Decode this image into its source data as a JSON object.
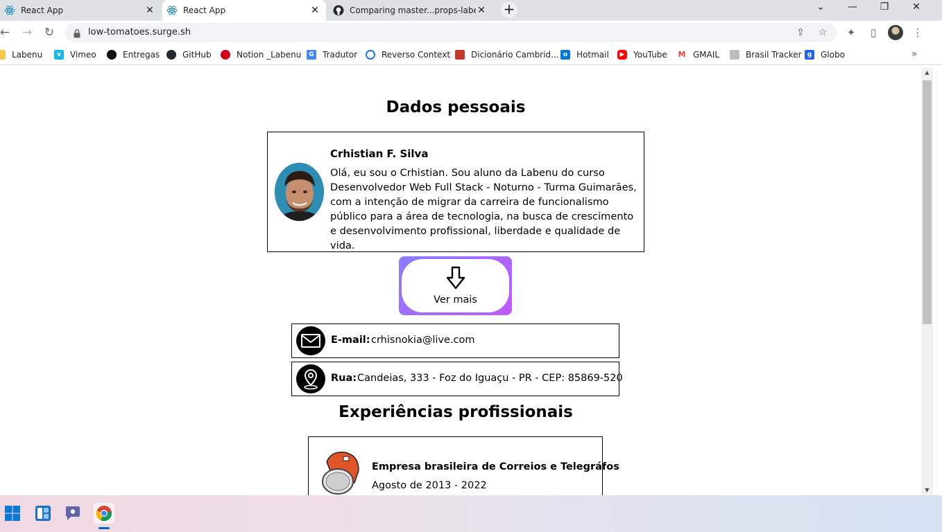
{
  "browser": {
    "tabs": [
      {
        "title": "React App",
        "active": false
      },
      {
        "title": "React App",
        "active": true
      },
      {
        "title": "Comparing master...props-labedi",
        "active": false
      }
    ],
    "new_tab_label": "+",
    "url": "low-tomatoes.surge.sh",
    "bookmarks": [
      {
        "label": "Labenu",
        "icon": "folder-yellow-icon",
        "color": "#f7c948"
      },
      {
        "label": "Vimeo",
        "icon": "vimeo-icon",
        "color": "#1ab7ea"
      },
      {
        "label": "Entregas",
        "icon": "black-circle-icon",
        "color": "#111111"
      },
      {
        "label": "GitHub",
        "icon": "github-icon",
        "color": "#24292e"
      },
      {
        "label": "Notion _Labenu",
        "icon": "apple-icon",
        "color": "#d0021b"
      },
      {
        "label": "Tradutor",
        "icon": "google-translate-icon",
        "color": "#4285f4"
      },
      {
        "label": "Reverso Context",
        "icon": "reverso-icon",
        "color": "#1a73e8"
      },
      {
        "label": "Dicionário Cambrid...",
        "icon": "cambridge-icon",
        "color": "#c0392b"
      },
      {
        "label": "Hotmail",
        "icon": "outlook-icon",
        "color": "#0078d4"
      },
      {
        "label": "YouTube",
        "icon": "youtube-icon",
        "color": "#ff0000"
      },
      {
        "label": "GMAIL",
        "icon": "gmail-icon",
        "color": "#ea4335"
      },
      {
        "label": "Brasil Tracker",
        "icon": "lock-gray-icon",
        "color": "#bdbdbd"
      },
      {
        "label": "Globo",
        "icon": "globo-icon",
        "color": "#2563eb"
      }
    ]
  },
  "page": {
    "personal_title": "Dados pessoais",
    "profile": {
      "name": "Crhistian F. Silva",
      "bio": "Olá, eu sou o Crhistian. Sou aluno da Labenu do curso Desenvolvedor Web Full Stack - Noturno - Turma Guimarães, com a intenção de migrar da carreira de funcionalismo público para a área de tecnologia, na busca de crescimento e desenvolvimento profissional, liberdade e qualidade de vida."
    },
    "ver_mais_label": "Ver mais",
    "email": {
      "key": "E-mail:",
      "value": "crhisnokia@live.com"
    },
    "address": {
      "key": "Rua:",
      "value": "Candeias, 333 - Foz do Iguaçu - PR - CEP: 85869-520"
    },
    "experience_title": "Experiências profissionais",
    "experiences": [
      {
        "company": "Empresa brasileira de Correios e Telegráfos",
        "period": "Agosto de 2013 - 2022"
      }
    ]
  },
  "colors": {
    "ver_mais_gradient_start": "#8a7bff",
    "ver_mais_gradient_end": "#c15bff"
  }
}
